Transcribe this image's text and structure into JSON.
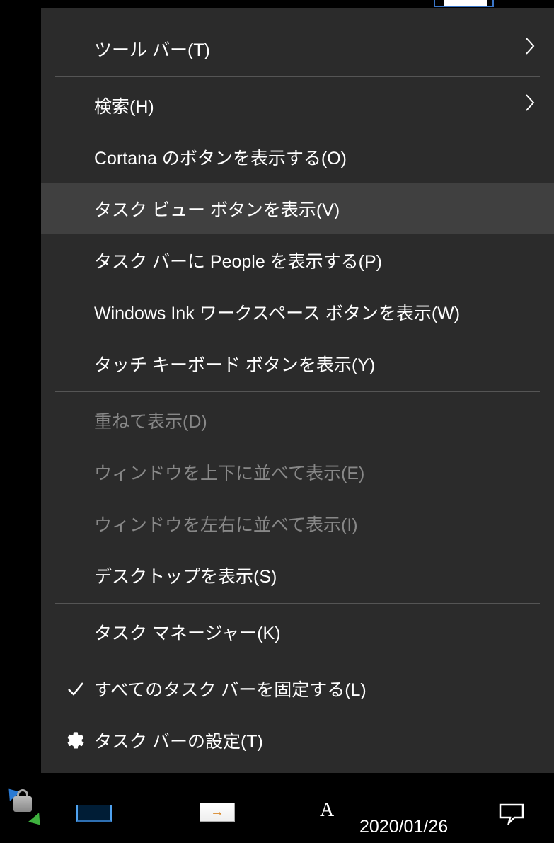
{
  "menu": {
    "toolbars": "ツール バー(T)",
    "search": "検索(H)",
    "cortana": "Cortana のボタンを表示する(O)",
    "taskview": "タスク ビュー ボタンを表示(V)",
    "people": "タスク バーに People を表示する(P)",
    "ink": "Windows Ink ワークスペース ボタンを表示(W)",
    "touchkb": "タッチ キーボード ボタンを表示(Y)",
    "cascade": "重ねて表示(D)",
    "stacked": "ウィンドウを上下に並べて表示(E)",
    "sidebyside": "ウィンドウを左右に並べて表示(I)",
    "showdesktop": "デスクトップを表示(S)",
    "taskmgr": "タスク マネージャー(K)",
    "lock": "すべてのタスク バーを固定する(L)",
    "settings": "タスク バーの設定(T)"
  },
  "taskbar": {
    "date": "2020/01/26",
    "mail_arrow": "→"
  }
}
